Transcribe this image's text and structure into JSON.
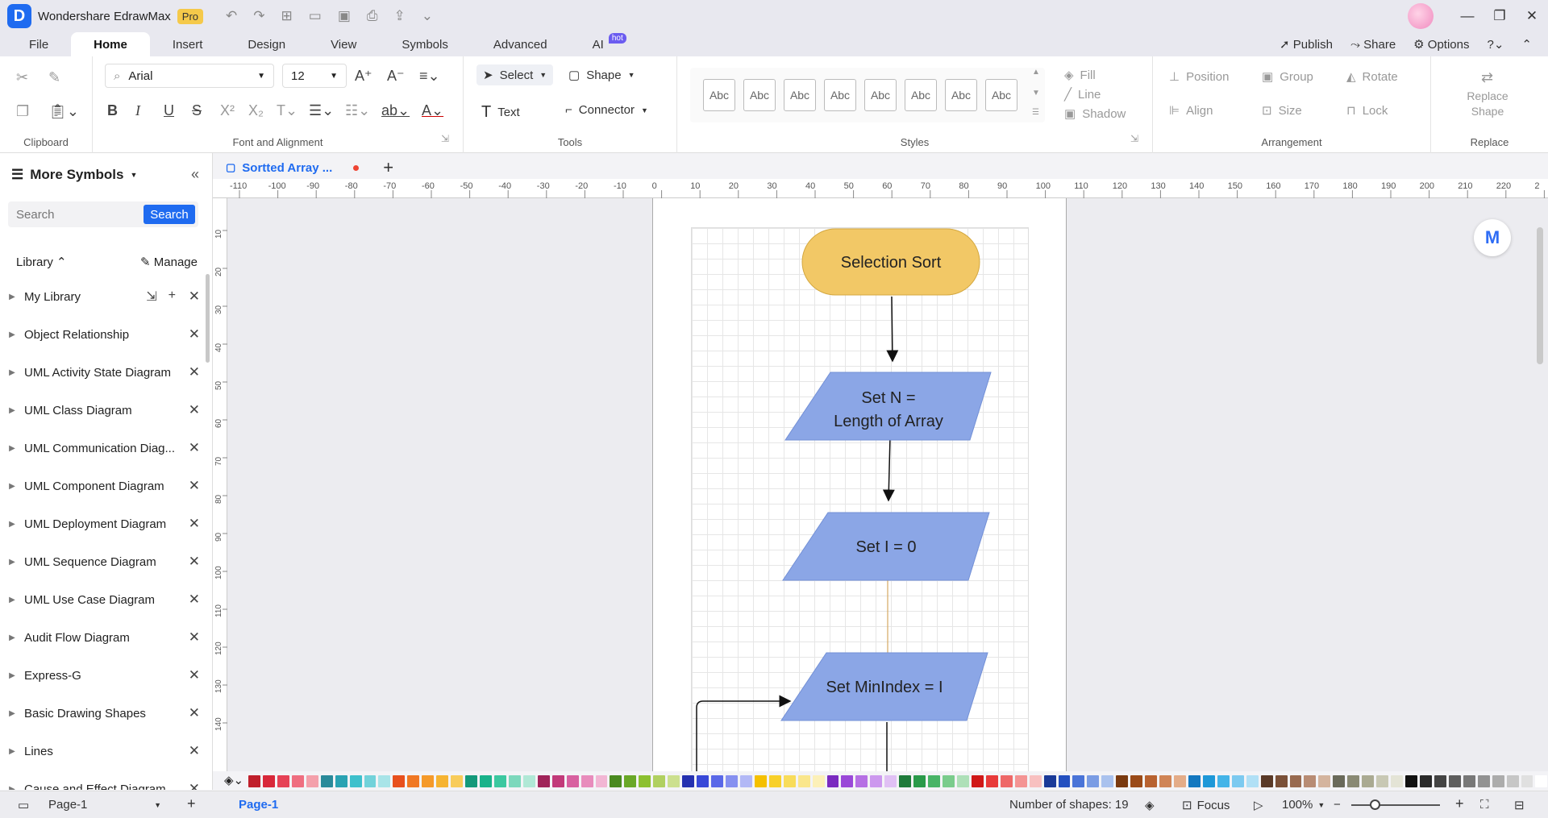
{
  "app": {
    "title": "Wondershare EdrawMax",
    "badge": "Pro"
  },
  "menu": {
    "tabs": [
      "File",
      "Home",
      "Insert",
      "Design",
      "View",
      "Symbols",
      "Advanced",
      "AI"
    ],
    "active": "Home",
    "ai_badge": "hot",
    "publish": "Publish",
    "share": "Share",
    "options": "Options"
  },
  "ribbon": {
    "font_name": "Arial",
    "font_size": "12",
    "select_label": "Select",
    "shape_label": "Shape",
    "text_label": "Text",
    "connector_label": "Connector",
    "style_samples": [
      "Abc",
      "Abc",
      "Abc",
      "Abc",
      "Abc",
      "Abc",
      "Abc",
      "Abc"
    ],
    "fill_label": "Fill",
    "line_label": "Line",
    "shadow_label": "Shadow",
    "position_label": "Position",
    "group_label": "Group",
    "rotate_label": "Rotate",
    "align_label": "Align",
    "size_label": "Size",
    "lock_label": "Lock",
    "replace_shape_label": "Replace Shape",
    "groups": {
      "clipboard": "Clipboard",
      "font": "Font and Alignment",
      "tools": "Tools",
      "styles": "Styles",
      "arrangement": "Arrangement",
      "replace": "Replace"
    }
  },
  "sidebar": {
    "title": "More Symbols",
    "search_placeholder": "Search",
    "search_button": "Search",
    "library_label": "Library",
    "manage_label": "Manage",
    "items": [
      "My Library",
      "Object Relationship",
      "UML Activity State Diagram",
      "UML Class Diagram",
      "UML Communication Diag...",
      "UML Component Diagram",
      "UML Deployment Diagram",
      "UML Sequence Diagram",
      "UML Use Case Diagram",
      "Audit Flow Diagram",
      "Express-G",
      "Basic Drawing Shapes",
      "Lines",
      "Cause and Effect Diagram"
    ]
  },
  "document": {
    "tab_title": "Sortted Array ..."
  },
  "ruler": {
    "h_ticks": [
      "-110",
      "-100",
      "-90",
      "-80",
      "-70",
      "-60",
      "-50",
      "-40",
      "-30",
      "-20",
      "-10",
      "0",
      "10",
      "20",
      "30",
      "40",
      "50",
      "60",
      "70",
      "80",
      "90",
      "100",
      "110",
      "120",
      "130",
      "140",
      "150",
      "160",
      "170",
      "180",
      "190",
      "200",
      "210",
      "220",
      "2"
    ],
    "v_ticks": [
      "10",
      "20",
      "30",
      "40",
      "50",
      "60",
      "70",
      "80",
      "90",
      "100",
      "110",
      "120",
      "130",
      "140"
    ]
  },
  "diagram": {
    "start": "Selection Sort",
    "step1_line1": "Set N =",
    "step1_line2": "Length of Array",
    "step2": "Set I = 0",
    "step3": "Set MinIndex = I",
    "colors": {
      "terminator": "#f2c866",
      "process": "#8ba6e6"
    }
  },
  "status": {
    "page_selector": "Page-1",
    "page_tab": "Page-1",
    "shape_count": "Number of shapes: 19",
    "focus": "Focus",
    "zoom": "100%"
  },
  "palette": [
    "#c0202c",
    "#d8283a",
    "#e64256",
    "#ef6e80",
    "#f4a0ab",
    "#2a8a9a",
    "#2aa3b3",
    "#3ec0cc",
    "#72d2da",
    "#a8e4e8",
    "#e8501e",
    "#f07824",
    "#f59a2a",
    "#f6b432",
    "#f8cc5a",
    "#13997a",
    "#19b28a",
    "#3cc8a0",
    "#7cd8bc",
    "#b0e8d6",
    "#a0245a",
    "#c23a7a",
    "#d860a0",
    "#e88cbc",
    "#f2b6d4",
    "#4a8a20",
    "#6aa828",
    "#8cc030",
    "#b0d060",
    "#cce08e",
    "#2430b0",
    "#3848d8",
    "#5a68e8",
    "#8690f0",
    "#b2b8f6",
    "#f5c000",
    "#f8d02a",
    "#f8dc5a",
    "#fae68c",
    "#fcf0b8",
    "#7a2ac0",
    "#9a48d8",
    "#b670e4",
    "#cc98ee",
    "#e0c0f4",
    "#1e7a3a",
    "#2a9a4a",
    "#48b466",
    "#7acc8c",
    "#aee0b8",
    "#d01818",
    "#e83a3a",
    "#ee6868",
    "#f49494",
    "#f8c0c0",
    "#1a3a98",
    "#2450c0",
    "#4a74d8",
    "#7a9ce4",
    "#aac2ee",
    "#7a3a10",
    "#9a4a18",
    "#b86230",
    "#d08456",
    "#e4ac88",
    "#1478c0",
    "#1e98d8",
    "#44b4e8",
    "#7ccaf0",
    "#b0e0f6",
    "#5a3a28",
    "#7a5038",
    "#986a50",
    "#b88c74",
    "#d4b49e",
    "#6a6a5a",
    "#8a8a74",
    "#aaaa92",
    "#c8c8b4",
    "#e4e4d6",
    "#111111",
    "#2a2a2a",
    "#444444",
    "#5e5e5e",
    "#787878",
    "#929292",
    "#acacac",
    "#c6c6c6",
    "#e0e0e0",
    "#ffffff"
  ]
}
